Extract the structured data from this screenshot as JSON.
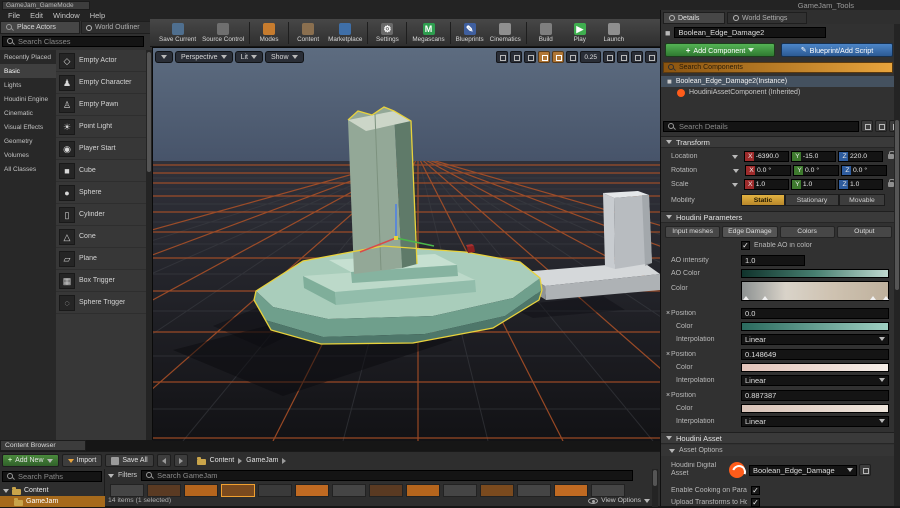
{
  "colors": {
    "accent_orange": "#e8930c",
    "selection_yellow": "#e8d23c",
    "axis_x": "#9e2b2b",
    "axis_y": "#3e7a2e",
    "axis_z": "#2e5c9e",
    "add_component_green": "#3f9b41",
    "blueprint_blue": "#3a75b8",
    "search_components_bar": "linear-gradient(90deg,#8a5410,#e8a43c)"
  },
  "icons": {
    "check": "✓",
    "close": "×",
    "plus": "+",
    "play": "▶",
    "gear": "⚙",
    "pencil": "✎"
  },
  "window": {
    "tab_title": "GameJam_GameMode",
    "app_title": "GameJam_Tools",
    "menu": [
      "File",
      "Edit",
      "Window",
      "Help"
    ]
  },
  "panels": {
    "place_actors_tab": "Place Actors",
    "world_outliner_tab": "World Outliner",
    "details_tab": "Details",
    "world_settings_tab": "World Settings",
    "content_browser_tab": "Content Browser"
  },
  "toolbar": {
    "buttons": [
      {
        "label": "Save Current",
        "icon_color": "#4f6f8f",
        "glyph": ""
      },
      {
        "label": "Source Control",
        "icon_color": "#6f6f6f",
        "glyph": ""
      },
      {
        "label": "Modes",
        "icon_color": "#c77c2e",
        "glyph": ""
      },
      {
        "label": "Content",
        "icon_color": "#8a6f4f",
        "glyph": ""
      },
      {
        "label": "Marketplace",
        "icon_color": "#3f6fa8",
        "glyph": ""
      },
      {
        "label": "Settings",
        "icon_color": "#6a6a6a",
        "glyph": "⚙"
      },
      {
        "label": "Megascans",
        "icon_color": "#2e9e4f",
        "glyph": "M"
      },
      {
        "label": "Blueprints",
        "icon_color": "#3f5f9f",
        "glyph": "✎"
      },
      {
        "label": "Cinematics",
        "icon_color": "#8f8f8f",
        "glyph": ""
      },
      {
        "label": "Build",
        "icon_color": "#7f7f7f",
        "glyph": ""
      },
      {
        "label": "Play",
        "icon_color": "#3fae4f",
        "glyph": "▶"
      },
      {
        "label": "Launch",
        "icon_color": "#8f8f8f",
        "glyph": ""
      }
    ]
  },
  "place_actors": {
    "search_placeholder": "Search Classes",
    "categories": [
      "Recently Placed",
      "Basic",
      "Lights",
      "Houdini Engine",
      "Cinematic",
      "Visual Effects",
      "Geometry",
      "Volumes",
      "All Classes"
    ],
    "items": [
      {
        "label": "Empty Actor",
        "icon": "◇"
      },
      {
        "label": "Empty Character",
        "icon": "♟"
      },
      {
        "label": "Empty Pawn",
        "icon": "♙"
      },
      {
        "label": "Point Light",
        "icon": "☀"
      },
      {
        "label": "Player Start",
        "icon": "◉"
      },
      {
        "label": "Cube",
        "icon": "■"
      },
      {
        "label": "Sphere",
        "icon": "●"
      },
      {
        "label": "Cylinder",
        "icon": "▯"
      },
      {
        "label": "Cone",
        "icon": "△"
      },
      {
        "label": "Plane",
        "icon": "▱"
      },
      {
        "label": "Box Trigger",
        "icon": "▦"
      },
      {
        "label": "Sphere Trigger",
        "icon": "◌"
      }
    ]
  },
  "viewport": {
    "perspective_label": "Perspective",
    "lit_label": "Lit",
    "show_label": "Show",
    "grid_snap_value": "0.25"
  },
  "details": {
    "instance_name": "Boolean_Edge_Damage2",
    "add_component_label": "Add Component",
    "blueprint_label": "Blueprint/Add Script",
    "search_components_placeholder": "Search Components",
    "components": [
      {
        "label": "Boolean_Edge_Damage2(Instance)"
      },
      {
        "label": "HoudiniAssetComponent (Inherited)"
      }
    ],
    "search_details_placeholder": "Search Details",
    "transform": {
      "header": "Transform",
      "axes": [
        "X",
        "Y",
        "Z"
      ],
      "rows": [
        {
          "label": "Location",
          "x": "-6390.0",
          "y": "-15.0",
          "z": "220.0"
        },
        {
          "label": "Rotation",
          "x": "0.0 °",
          "y": "0.0 °",
          "z": "0.0 °"
        },
        {
          "label": "Scale",
          "x": "1.0",
          "y": "1.0",
          "z": "1.0"
        }
      ],
      "mobility_label": "Mobility",
      "mobility_options": [
        "Static",
        "Stationary",
        "Movable"
      ],
      "mobility_active": "Static"
    },
    "houdini_parameters": {
      "header": "Houdini Parameters",
      "tabs": [
        "Input meshes",
        "Edge Damage",
        "Colors",
        "Output"
      ],
      "enable_ao_label": "Enable AO in color",
      "ao_intensity_label": "AO intensity",
      "ao_intensity_value": "1.0",
      "ao_color_label": "AO Color",
      "ao_color_gradient": "linear-gradient(90deg,#10332c,#477f70,#bfd9d0)",
      "color_label": "Color",
      "color_ramp_gradient": "linear-gradient(90deg,#8d9292,#d9d3c9 30%,#cfc3b2 60%,#bfb19d)",
      "position_label": "Position",
      "interpolation_label": "Interpolation",
      "points": [
        {
          "position": "0.0",
          "color": "linear-gradient(90deg,#2a6a5e,#9fd0c2)",
          "interpolation": "Linear"
        },
        {
          "position": "0.148649",
          "color": "linear-gradient(90deg,#e3c4ba,#f6efe9)",
          "interpolation": "Linear"
        },
        {
          "position": "0.887387",
          "color": "linear-gradient(90deg,#d9c3b8,#efe6dd)",
          "interpolation": "Linear"
        }
      ]
    },
    "houdini_asset": {
      "header": "Houdini Asset",
      "asset_options_label": "Asset Options",
      "digital_asset_label": "Houdini Digital Asset",
      "digital_asset_value": "Boolean_Edge_Damage",
      "options": [
        {
          "label": "Enable Cooking on Paramet"
        },
        {
          "label": "Upload Transforms to Houd"
        }
      ]
    }
  },
  "content_browser": {
    "add_new_label": "Add New",
    "import_label": "Import",
    "save_all_label": "Save All",
    "breadcrumb": [
      "Content",
      "GameJam"
    ],
    "search_paths_placeholder": "Search Paths",
    "folders": [
      "Content",
      "GameJam"
    ],
    "filters_label": "Filters",
    "search_placeholder": "Search GameJam",
    "status_text": "14 items (1 selected)",
    "view_options_label": "View Options"
  }
}
